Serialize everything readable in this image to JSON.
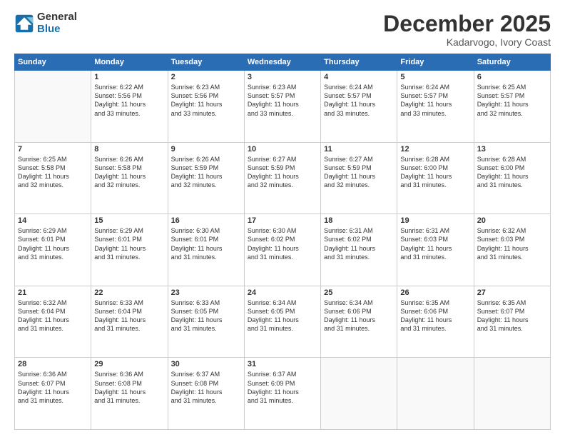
{
  "header": {
    "logo_general": "General",
    "logo_blue": "Blue",
    "month": "December 2025",
    "location": "Kadarvogo, Ivory Coast"
  },
  "days_of_week": [
    "Sunday",
    "Monday",
    "Tuesday",
    "Wednesday",
    "Thursday",
    "Friday",
    "Saturday"
  ],
  "weeks": [
    [
      {
        "day": "",
        "info": ""
      },
      {
        "day": "1",
        "info": "Sunrise: 6:22 AM\nSunset: 5:56 PM\nDaylight: 11 hours\nand 33 minutes."
      },
      {
        "day": "2",
        "info": "Sunrise: 6:23 AM\nSunset: 5:56 PM\nDaylight: 11 hours\nand 33 minutes."
      },
      {
        "day": "3",
        "info": "Sunrise: 6:23 AM\nSunset: 5:57 PM\nDaylight: 11 hours\nand 33 minutes."
      },
      {
        "day": "4",
        "info": "Sunrise: 6:24 AM\nSunset: 5:57 PM\nDaylight: 11 hours\nand 33 minutes."
      },
      {
        "day": "5",
        "info": "Sunrise: 6:24 AM\nSunset: 5:57 PM\nDaylight: 11 hours\nand 33 minutes."
      },
      {
        "day": "6",
        "info": "Sunrise: 6:25 AM\nSunset: 5:57 PM\nDaylight: 11 hours\nand 32 minutes."
      }
    ],
    [
      {
        "day": "7",
        "info": "Sunrise: 6:25 AM\nSunset: 5:58 PM\nDaylight: 11 hours\nand 32 minutes."
      },
      {
        "day": "8",
        "info": "Sunrise: 6:26 AM\nSunset: 5:58 PM\nDaylight: 11 hours\nand 32 minutes."
      },
      {
        "day": "9",
        "info": "Sunrise: 6:26 AM\nSunset: 5:59 PM\nDaylight: 11 hours\nand 32 minutes."
      },
      {
        "day": "10",
        "info": "Sunrise: 6:27 AM\nSunset: 5:59 PM\nDaylight: 11 hours\nand 32 minutes."
      },
      {
        "day": "11",
        "info": "Sunrise: 6:27 AM\nSunset: 5:59 PM\nDaylight: 11 hours\nand 32 minutes."
      },
      {
        "day": "12",
        "info": "Sunrise: 6:28 AM\nSunset: 6:00 PM\nDaylight: 11 hours\nand 31 minutes."
      },
      {
        "day": "13",
        "info": "Sunrise: 6:28 AM\nSunset: 6:00 PM\nDaylight: 11 hours\nand 31 minutes."
      }
    ],
    [
      {
        "day": "14",
        "info": "Sunrise: 6:29 AM\nSunset: 6:01 PM\nDaylight: 11 hours\nand 31 minutes."
      },
      {
        "day": "15",
        "info": "Sunrise: 6:29 AM\nSunset: 6:01 PM\nDaylight: 11 hours\nand 31 minutes."
      },
      {
        "day": "16",
        "info": "Sunrise: 6:30 AM\nSunset: 6:01 PM\nDaylight: 11 hours\nand 31 minutes."
      },
      {
        "day": "17",
        "info": "Sunrise: 6:30 AM\nSunset: 6:02 PM\nDaylight: 11 hours\nand 31 minutes."
      },
      {
        "day": "18",
        "info": "Sunrise: 6:31 AM\nSunset: 6:02 PM\nDaylight: 11 hours\nand 31 minutes."
      },
      {
        "day": "19",
        "info": "Sunrise: 6:31 AM\nSunset: 6:03 PM\nDaylight: 11 hours\nand 31 minutes."
      },
      {
        "day": "20",
        "info": "Sunrise: 6:32 AM\nSunset: 6:03 PM\nDaylight: 11 hours\nand 31 minutes."
      }
    ],
    [
      {
        "day": "21",
        "info": "Sunrise: 6:32 AM\nSunset: 6:04 PM\nDaylight: 11 hours\nand 31 minutes."
      },
      {
        "day": "22",
        "info": "Sunrise: 6:33 AM\nSunset: 6:04 PM\nDaylight: 11 hours\nand 31 minutes."
      },
      {
        "day": "23",
        "info": "Sunrise: 6:33 AM\nSunset: 6:05 PM\nDaylight: 11 hours\nand 31 minutes."
      },
      {
        "day": "24",
        "info": "Sunrise: 6:34 AM\nSunset: 6:05 PM\nDaylight: 11 hours\nand 31 minutes."
      },
      {
        "day": "25",
        "info": "Sunrise: 6:34 AM\nSunset: 6:06 PM\nDaylight: 11 hours\nand 31 minutes."
      },
      {
        "day": "26",
        "info": "Sunrise: 6:35 AM\nSunset: 6:06 PM\nDaylight: 11 hours\nand 31 minutes."
      },
      {
        "day": "27",
        "info": "Sunrise: 6:35 AM\nSunset: 6:07 PM\nDaylight: 11 hours\nand 31 minutes."
      }
    ],
    [
      {
        "day": "28",
        "info": "Sunrise: 6:36 AM\nSunset: 6:07 PM\nDaylight: 11 hours\nand 31 minutes."
      },
      {
        "day": "29",
        "info": "Sunrise: 6:36 AM\nSunset: 6:08 PM\nDaylight: 11 hours\nand 31 minutes."
      },
      {
        "day": "30",
        "info": "Sunrise: 6:37 AM\nSunset: 6:08 PM\nDaylight: 11 hours\nand 31 minutes."
      },
      {
        "day": "31",
        "info": "Sunrise: 6:37 AM\nSunset: 6:09 PM\nDaylight: 11 hours\nand 31 minutes."
      },
      {
        "day": "",
        "info": ""
      },
      {
        "day": "",
        "info": ""
      },
      {
        "day": "",
        "info": ""
      }
    ]
  ]
}
